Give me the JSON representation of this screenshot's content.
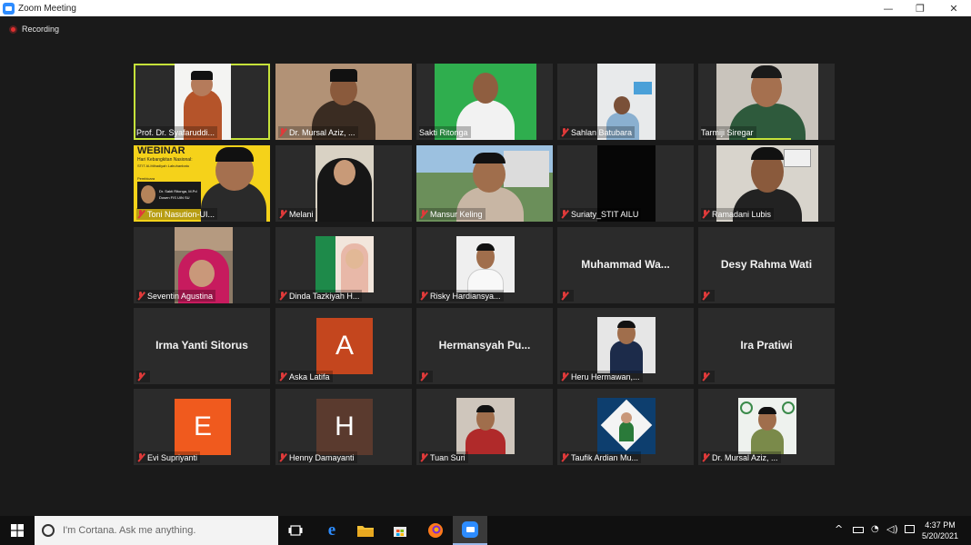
{
  "window": {
    "title": "Zoom Meeting",
    "minimize": "—",
    "maximize": "❐",
    "close": "✕"
  },
  "recording": {
    "label": "Recording"
  },
  "participants": [
    {
      "name": "Prof. Dr. Syafaruddi...",
      "type": "video",
      "muted": false,
      "active": true
    },
    {
      "name": "Dr. Mursal Aziz, ...",
      "type": "video",
      "muted": true
    },
    {
      "name": "Sakti Ritonga",
      "type": "video",
      "muted": false
    },
    {
      "name": "Sahlan Batubara",
      "type": "video",
      "muted": true
    },
    {
      "name": "Tarmiji Siregar",
      "type": "video",
      "muted": false
    },
    {
      "name": "Toni Nasution-UI...",
      "type": "video",
      "muted": true,
      "banner": {
        "title": "WEBINAR",
        "subtitle": "Hari Kebangkitan Nasional:",
        "org": "STIT Al-Ittihadiyah Labuhanbatu",
        "tag": "Pembicara",
        "speaker": "Dr. Sakti Ritonga, M.Pd",
        "role": "Dosen FIS UIN SU"
      }
    },
    {
      "name": "Melani",
      "type": "video",
      "muted": true
    },
    {
      "name": "Mansur Keling",
      "type": "video",
      "muted": true
    },
    {
      "name": "Suriaty_STIT AILU",
      "type": "video",
      "muted": true
    },
    {
      "name": "Ramadani Lubis",
      "type": "video",
      "muted": true
    },
    {
      "name": "Seventin Agustina",
      "type": "video",
      "muted": true
    },
    {
      "name": "Dinda Tazkiyah H...",
      "type": "video",
      "muted": true
    },
    {
      "name": "Risky Hardiansya...",
      "type": "video",
      "muted": true
    },
    {
      "name": "",
      "center": "Muhammad  Wa...",
      "type": "text",
      "muted": true
    },
    {
      "name": "",
      "center": "Desy Rahma Wati",
      "type": "text",
      "muted": true
    },
    {
      "name": "",
      "center": "Irma Yanti Sitorus",
      "type": "text",
      "muted": true
    },
    {
      "name": "Aska Latifa",
      "type": "letter",
      "letter": "A",
      "color": "#c4461e",
      "muted": true
    },
    {
      "name": "",
      "center": "Hermansyah  Pu...",
      "type": "text",
      "muted": true
    },
    {
      "name": "Heru Hermawan,...",
      "type": "video",
      "muted": true
    },
    {
      "name": "",
      "center": "Ira Pratiwi",
      "type": "text",
      "muted": true
    },
    {
      "name": "Evi Supriyanti",
      "type": "letter",
      "letter": "E",
      "color": "#f05a1e",
      "muted": true
    },
    {
      "name": "Henny Damayanti",
      "type": "letter",
      "letter": "H",
      "color": "#5a3a2e",
      "muted": true
    },
    {
      "name": "Tuan Suri",
      "type": "video",
      "muted": true
    },
    {
      "name": "Taufik Ardian Mu...",
      "type": "video",
      "muted": true
    },
    {
      "name": "Dr. Mursal Aziz, ...",
      "type": "video",
      "muted": true
    }
  ],
  "taskbar": {
    "cortana_placeholder": "I'm Cortana. Ask me anything.",
    "time": "4:37 PM",
    "date": "5/20/2021"
  }
}
